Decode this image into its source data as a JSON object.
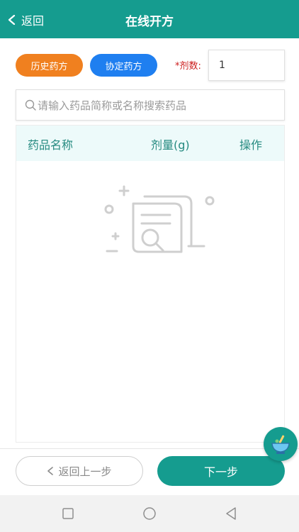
{
  "header": {
    "back_label": "返回",
    "title": "在线开方"
  },
  "prescription": {
    "history_button": "历史药方",
    "agreed_button": "协定药方",
    "dose_label": "*剂数:",
    "dose_value": "1"
  },
  "search": {
    "placeholder": "请输入药品简称或名称搜索药品"
  },
  "table": {
    "columns": [
      "药品名称",
      "剂量(g)",
      "操作"
    ],
    "rows": []
  },
  "footer": {
    "prev_label": "返回上一步",
    "next_label": "下一步"
  },
  "colors": {
    "primary": "#159c8f",
    "history": "#f0801f",
    "agreed": "#1f7ff0",
    "required": "#cc1d1d"
  },
  "icons": {
    "back": "chevron-left-icon",
    "search": "search-icon",
    "empty": "empty-document-search-icon",
    "fab": "mortar-pestle-icon"
  }
}
